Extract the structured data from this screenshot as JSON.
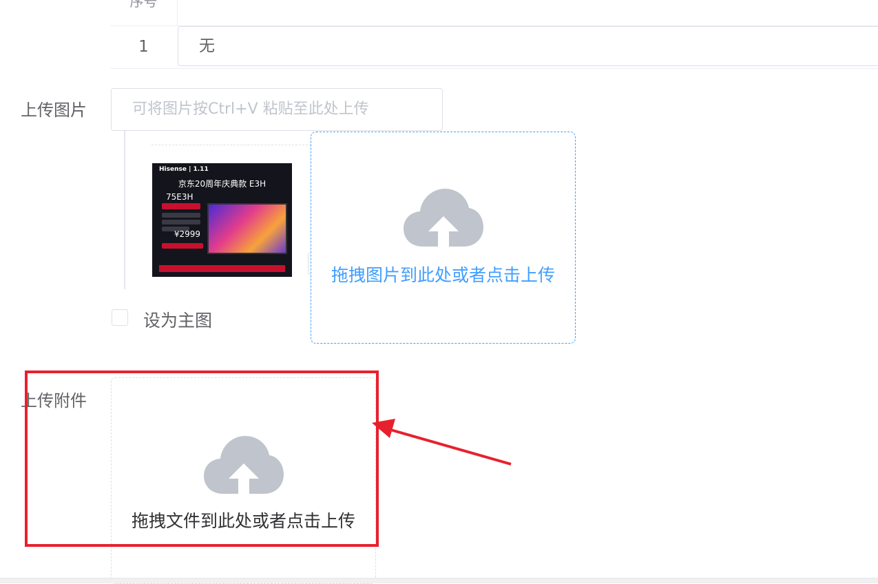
{
  "table": {
    "header_partial": "序号",
    "row": {
      "index": "1",
      "value": "无"
    }
  },
  "upload_image": {
    "label": "上传图片",
    "paste_placeholder": "可将图片按Ctrl+V 粘贴至此处上传",
    "drop_text": "拖拽图片到此处或者点击上传",
    "set_main_label": "设为主图",
    "thumbnail": {
      "brand": "Hisense | 1.11",
      "title": "京东20周年庆典款 E3H",
      "model": "75E3H",
      "price": "¥2999"
    }
  },
  "upload_attachment": {
    "label": "上传附件",
    "drop_text": "拖拽文件到此处或者点击上传"
  },
  "colors": {
    "accent": "#409eff",
    "highlight": "#e8202e",
    "icon": "#c0c4cc"
  }
}
